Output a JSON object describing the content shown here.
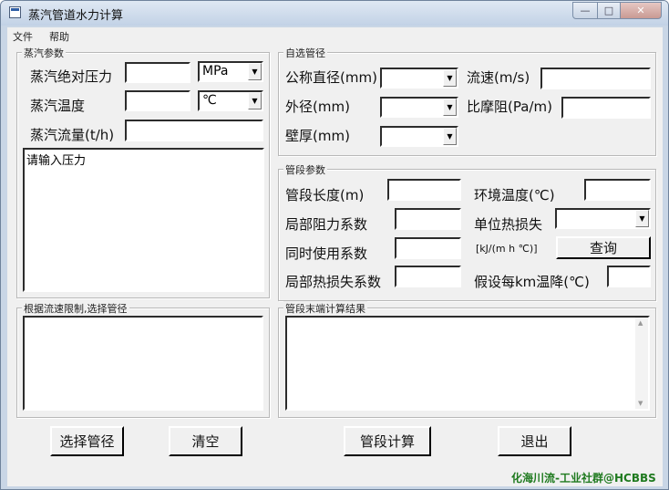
{
  "window": {
    "title": "蒸汽管道水力计算",
    "minimize": "—",
    "maximize": "□",
    "close": "✕"
  },
  "menu": [
    "文件",
    "帮助"
  ],
  "steam_params": {
    "group_label": "蒸汽参数",
    "pressure_label": "蒸汽绝对压力",
    "pressure_unit": "MPa",
    "temperature_label": "蒸汽温度",
    "temperature_unit": "℃",
    "flow_label": "蒸汽流量(t/h)",
    "message": "请输入压力"
  },
  "pipe_select": {
    "group_label": "自选管径",
    "nominal_label": "公称直径(mm)",
    "outer_label": "外径(mm)",
    "wall_label": "壁厚(mm)",
    "velocity_label": "流速(m/s)",
    "friction_label": "比摩阻(Pa/m)"
  },
  "segment_params": {
    "group_label": "管段参数",
    "length_label": "管段长度(m)",
    "local_resistance_label": "局部阻力系数",
    "simultaneous_label": "同时使用系数",
    "local_heatloss_label": "局部热损失系数",
    "ambient_label": "环境温度(℃)",
    "unit_heatloss_label": "单位热损失",
    "unit_heatloss_unit": "[kJ/(m h ℃)]",
    "query_button": "查询",
    "temp_drop_label": "假设每km温降(℃)"
  },
  "flow_limit": {
    "group_label": "根据流速限制,选择管径"
  },
  "results": {
    "group_label": "管段末端计算结果"
  },
  "buttons": {
    "select_pipe": "选择管径",
    "clear": "清空",
    "calculate": "管段计算",
    "exit": "退出"
  },
  "watermark": "化海川流-工业社群@HCBBS"
}
